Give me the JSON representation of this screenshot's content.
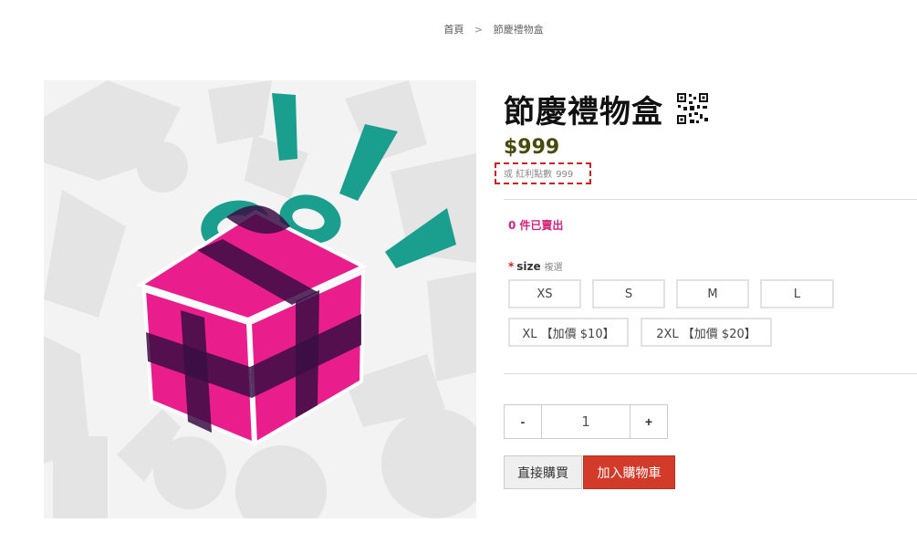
{
  "breadcrumb": {
    "home": "首頁",
    "separator": ">",
    "current": "節慶禮物盒"
  },
  "product": {
    "title": "節慶禮物盒",
    "price": "$999",
    "bonus_prefix": "或 紅利點數",
    "bonus_points": "999",
    "sold_count": "0",
    "sold_label": "件已賣出"
  },
  "options": {
    "required_mark": "*",
    "name": "size",
    "hint": "複選",
    "sizes": [
      "XS",
      "S",
      "M",
      "L",
      "XL 【加價 $10】",
      "2XL 【加價 $20】"
    ]
  },
  "quantity": {
    "minus": "-",
    "value": "1",
    "plus": "+"
  },
  "actions": {
    "buy_now": "直接購買",
    "add_to_cart": "加入購物車"
  },
  "colors": {
    "box_pink": "#e91e8c",
    "ribbon_dark": "#3a0d44",
    "teal": "#1a9e8e",
    "add_cart": "#d23b2a",
    "price": "#4a4a0f"
  }
}
